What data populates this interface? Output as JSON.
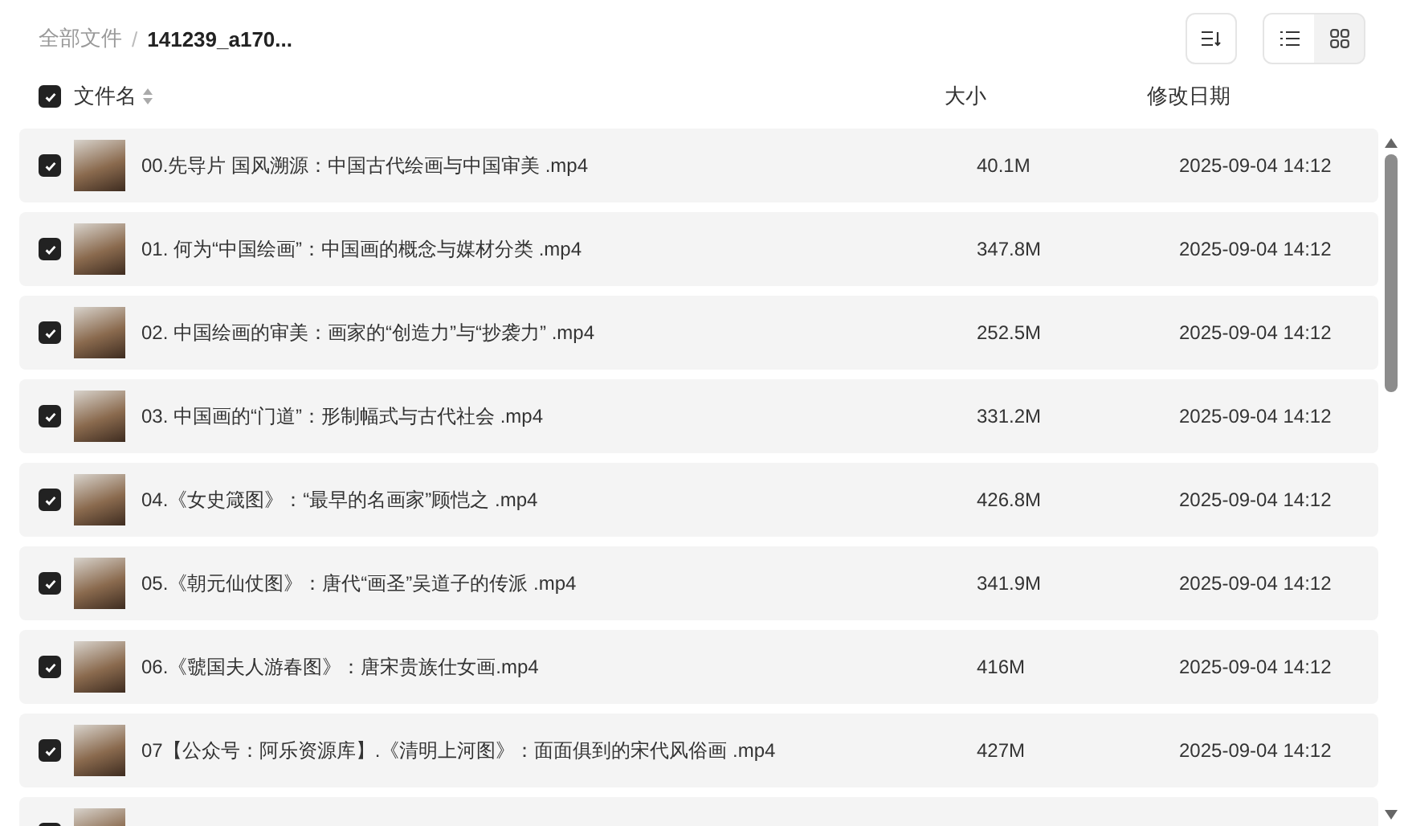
{
  "breadcrumb_separator": "/",
  "breadcrumb": [
    {
      "label": "全部文件",
      "current": false
    },
    {
      "label": "141239_a170...",
      "current": true
    }
  ],
  "view_toggle": [
    {
      "kind": "list",
      "selected": true
    },
    {
      "kind": "grid",
      "selected": false
    }
  ],
  "header": {
    "select_all": {
      "checked": true
    },
    "columns": [
      "文件名",
      "大小",
      "修改日期"
    ]
  },
  "files": [
    {
      "checked": true,
      "name": "00.先导片 国风溯源：中国古代绘画与中国审美 .mp4",
      "size": "40.1M",
      "date": "2025-09-04 14:12"
    },
    {
      "checked": true,
      "name": "01. 何为“中国绘画”：中国画的概念与媒材分类 .mp4",
      "size": "347.8M",
      "date": "2025-09-04 14:12"
    },
    {
      "checked": true,
      "name": "02. 中国绘画的审美：画家的“创造力”与“抄袭力” .mp4",
      "size": "252.5M",
      "date": "2025-09-04 14:12"
    },
    {
      "checked": true,
      "name": "03. 中国画的“门道”：形制幅式与古代社会 .mp4",
      "size": "331.2M",
      "date": "2025-09-04 14:12"
    },
    {
      "checked": true,
      "name": "04.《女史箴图》：“最早的名画家”顾恺之 .mp4",
      "size": "426.8M",
      "date": "2025-09-04 14:12"
    },
    {
      "checked": true,
      "name": "05.《朝元仙仗图》：唐代“画圣”吴道子的传派 .mp4",
      "size": "341.9M",
      "date": "2025-09-04 14:12"
    },
    {
      "checked": true,
      "name": "06.《虢国夫人游春图》：唐宋贵族仕女画.mp4",
      "size": "416M",
      "date": "2025-09-04 14:12"
    },
    {
      "checked": true,
      "name": "07【公众号：阿乐资源库】.《清明上河图》：面面俱到的宋代风俗画 .mp4",
      "size": "427M",
      "date": "2025-09-04 14:12"
    },
    {
      "checked": true
    }
  ]
}
